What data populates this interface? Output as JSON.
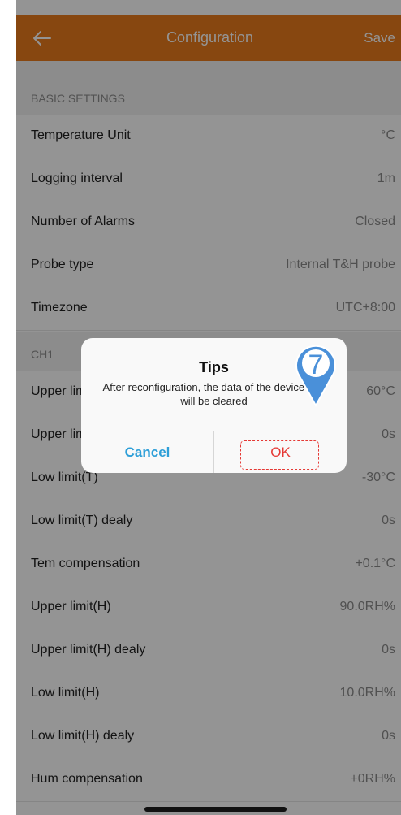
{
  "header": {
    "title": "Configuration",
    "save_label": "Save"
  },
  "basic": {
    "title": "BASIC SETTINGS",
    "rows": [
      {
        "label": "Temperature Unit",
        "value": "°C"
      },
      {
        "label": "Logging interval",
        "value": "1m"
      },
      {
        "label": "Number of Alarms",
        "value": "Closed"
      },
      {
        "label": "Probe type",
        "value": "Internal T&H probe"
      },
      {
        "label": "Timezone",
        "value": "UTC+8:00"
      }
    ]
  },
  "ch1": {
    "title": "CH1",
    "rows": [
      {
        "label": "Upper limit(T)",
        "value": "60°C"
      },
      {
        "label": "Upper limit(T) dealy",
        "value": "0s"
      },
      {
        "label": "Low limit(T)",
        "value": "-30°C"
      },
      {
        "label": "Low limit(T) dealy",
        "value": "0s"
      },
      {
        "label": "Tem compensation",
        "value": "+0.1°C"
      },
      {
        "label": "Upper limit(H)",
        "value": "90.0RH%"
      },
      {
        "label": "Upper limit(H) dealy",
        "value": "0s"
      },
      {
        "label": "Low limit(H)",
        "value": "10.0RH%"
      },
      {
        "label": "Low limit(H) dealy",
        "value": "0s"
      },
      {
        "label": "Hum compensation",
        "value": "+0RH%"
      }
    ]
  },
  "dialog": {
    "title": "Tips",
    "message": "After reconfiguration, the data of the device end will be cleared",
    "cancel_label": "Cancel",
    "ok_label": "OK"
  },
  "step_marker": {
    "number": "7",
    "color": "#4a90d9"
  },
  "colors": {
    "accent": "#e97a1d",
    "cancel": "#2e9fd8",
    "ok": "#e53935"
  }
}
